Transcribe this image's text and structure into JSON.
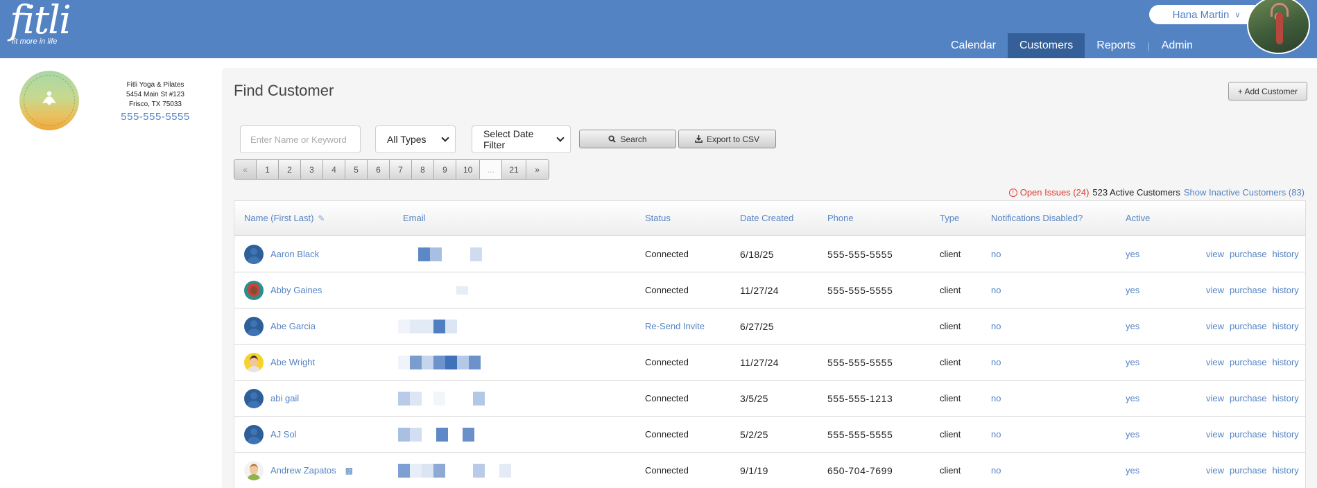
{
  "header": {
    "logo_text": "fitli",
    "logo_tagline": "fit more in life",
    "user_name": "Hana Martin",
    "nav": [
      "Calendar",
      "Customers",
      "Reports",
      "Admin"
    ],
    "active_nav": "Customers"
  },
  "studio": {
    "name": "Fitli Yoga & Pilates",
    "address1": "5454 Main St #123",
    "address2": "Frisco, TX 75033",
    "phone": "555-555-5555"
  },
  "page": {
    "title": "Find Customer",
    "add_button": "+ Add Customer"
  },
  "filters": {
    "search_placeholder": "Enter Name or Keyword",
    "search_value": "",
    "type_select": "All Types",
    "date_select": "Select Date Filter",
    "search_button": "Search",
    "export_button": "Export to CSV"
  },
  "pagination": {
    "prev": "«",
    "pages": [
      "1",
      "2",
      "3",
      "4",
      "5",
      "6",
      "7",
      "8",
      "9",
      "10"
    ],
    "ellipsis": "...",
    "last": "21",
    "next": "»"
  },
  "summary": {
    "open_issues": "Open Issues (24)",
    "active_customers": "523 Active Customers",
    "show_inactive": "Show Inactive Customers (83)"
  },
  "table": {
    "columns": [
      "Name (First Last)",
      "Email",
      "Status",
      "Date Created",
      "Phone",
      "Type",
      "Notifications Disabled?",
      "Active"
    ],
    "action_labels": [
      "view",
      "purchase",
      "history"
    ],
    "rows": [
      {
        "name": "Aaron Black",
        "avatar": "default",
        "status": "Connected",
        "date": "6/18/25",
        "phone": "555-555-5555",
        "type": "client",
        "notif": "no",
        "active": "yes"
      },
      {
        "name": "Abby Gaines",
        "avatar": "abby",
        "status": "Connected",
        "date": "11/27/24",
        "phone": "555-555-5555",
        "type": "client",
        "notif": "no",
        "active": "yes"
      },
      {
        "name": "Abe Garcia",
        "avatar": "default",
        "status": "Re-Send Invite",
        "date": "6/27/25",
        "phone": "",
        "type": "client",
        "notif": "no",
        "active": "yes"
      },
      {
        "name": "Abe Wright",
        "avatar": "abe",
        "status": "Connected",
        "date": "11/27/24",
        "phone": "555-555-5555",
        "type": "client",
        "notif": "no",
        "active": "yes"
      },
      {
        "name": "abi gail",
        "avatar": "default",
        "status": "Connected",
        "date": "3/5/25",
        "phone": "555-555-1213",
        "type": "client",
        "notif": "no",
        "active": "yes"
      },
      {
        "name": "AJ Sol",
        "avatar": "default",
        "status": "Connected",
        "date": "5/2/25",
        "phone": "555-555-5555",
        "type": "client",
        "notif": "no",
        "active": "yes"
      },
      {
        "name": "Andrew Zapatos",
        "avatar": "andrew",
        "status": "Connected",
        "date": "9/1/19",
        "phone": "650-704-7699",
        "type": "client",
        "notif": "no",
        "active": "yes"
      }
    ]
  },
  "colors": {
    "brand": "#5483c3",
    "nav_active": "#345f98",
    "issues": "#e03a2f"
  }
}
